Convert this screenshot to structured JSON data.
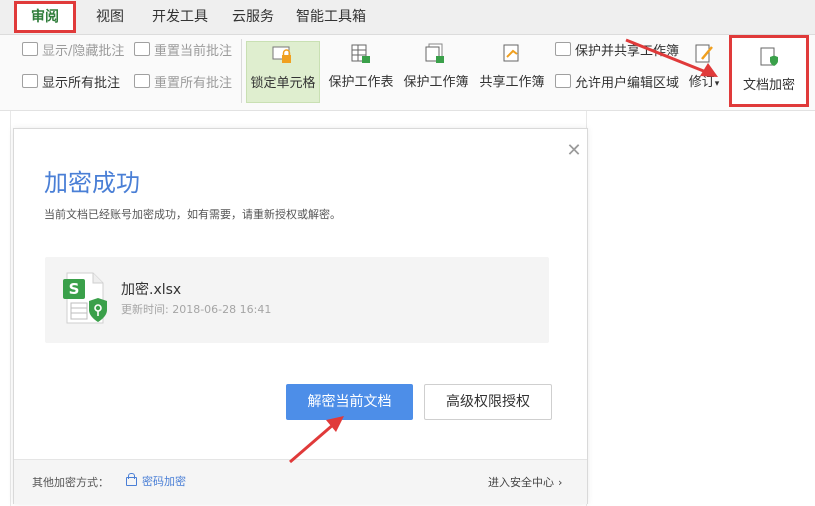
{
  "tabs": [
    {
      "label": "审阅",
      "active": true
    },
    {
      "label": "视图"
    },
    {
      "label": "开发工具"
    },
    {
      "label": "云服务"
    },
    {
      "label": "智能工具箱"
    }
  ],
  "ribbon": {
    "comments": {
      "show_hide": "显示/隐藏批注",
      "reset_current": "重置当前批注",
      "show_all": "显示所有批注",
      "reset_all": "重置所有批注"
    },
    "lock_cell": "锁定单元格",
    "protect_sheet": "保护工作表",
    "protect_workbook": "保护工作簿",
    "share_workbook": "共享工作簿",
    "protect_and_share": "保护并共享工作簿",
    "allow_edit_ranges": "允许用户编辑区域",
    "track_changes": "修订",
    "doc_encrypt": "文档加密"
  },
  "dialog": {
    "title": "加密成功",
    "description": "当前文档已经账号加密成功，如有需要，请重新授权或解密。",
    "file": {
      "name": "加密.xlsx",
      "updated": "更新时间: 2018-06-28 16:41"
    },
    "decrypt_button": "解密当前文档",
    "advanced_button": "高级权限授权",
    "footer": {
      "other_methods_label": "其他加密方式：",
      "password_encrypt": "密码加密",
      "security_center": "进入安全中心"
    }
  },
  "colors": {
    "accent_blue": "#4d8ee8",
    "title_blue": "#4a7fd6",
    "highlight_red": "#e03a3a",
    "excel_green": "#3aa04a"
  }
}
